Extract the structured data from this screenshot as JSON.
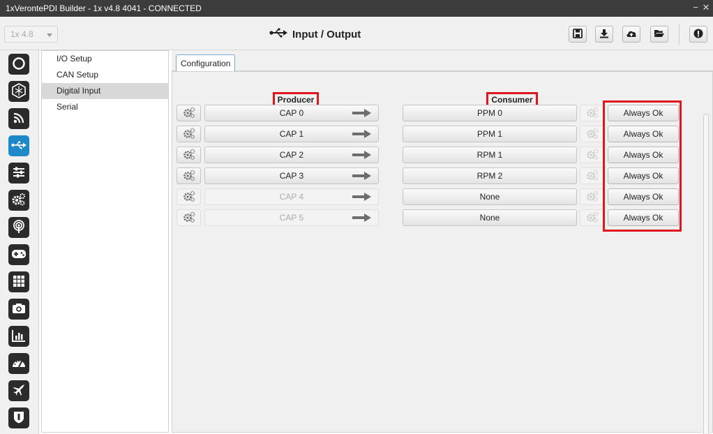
{
  "window": {
    "title": "1xVerontePDI Builder - 1x v4.8 4041 - CONNECTED",
    "minimize_glyph": "−",
    "close_glyph": "✕"
  },
  "toolbar": {
    "version_value": "1x 4.8",
    "page_title": "Input / Output",
    "page_icon": "usb-icon",
    "buttons": [
      "save-icon",
      "download-icon",
      "cloud-upload-icon",
      "folder-open-icon",
      "alert-icon"
    ]
  },
  "sidebar_icons": [
    {
      "name": "status-ring-icon",
      "active": false
    },
    {
      "name": "hexagon-icon",
      "active": false
    },
    {
      "name": "rss-feed-icon",
      "active": false
    },
    {
      "name": "usb-icon",
      "active": true
    },
    {
      "name": "sliders-icon",
      "active": false
    },
    {
      "name": "gears-icon",
      "active": false
    },
    {
      "name": "podcast-icon",
      "active": false
    },
    {
      "name": "gamepad-icon",
      "active": false
    },
    {
      "name": "grid-icon",
      "active": false
    },
    {
      "name": "camera-icon",
      "active": false
    },
    {
      "name": "bar-chart-icon",
      "active": false
    },
    {
      "name": "dashboard-icon",
      "active": false
    },
    {
      "name": "airplane-icon",
      "active": false
    },
    {
      "name": "shield-icon",
      "active": false
    }
  ],
  "tree": {
    "items": [
      {
        "label": "I/O Setup",
        "selected": false
      },
      {
        "label": "CAN Setup",
        "selected": false
      },
      {
        "label": "Digital Input",
        "selected": true
      },
      {
        "label": "Serial",
        "selected": false
      }
    ]
  },
  "tabs": [
    {
      "label": "Configuration",
      "active": true
    }
  ],
  "table": {
    "producer_header": "Producer",
    "consumer_header": "Consumer",
    "rows": [
      {
        "producer": "CAP 0",
        "producer_enabled": true,
        "consumer": "PPM 0",
        "status": "Always Ok"
      },
      {
        "producer": "CAP 1",
        "producer_enabled": true,
        "consumer": "PPM 1",
        "status": "Always Ok"
      },
      {
        "producer": "CAP 2",
        "producer_enabled": true,
        "consumer": "RPM 1",
        "status": "Always Ok"
      },
      {
        "producer": "CAP 3",
        "producer_enabled": true,
        "consumer": "RPM 2",
        "status": "Always Ok"
      },
      {
        "producer": "CAP 4",
        "producer_enabled": false,
        "consumer": "None",
        "status": "Always Ok"
      },
      {
        "producer": "CAP 5",
        "producer_enabled": false,
        "consumer": "None",
        "status": "Always Ok"
      }
    ]
  },
  "colors": {
    "accent": "#1e88c8",
    "highlight": "#e0161e",
    "titlebar": "#3c3c3c"
  }
}
